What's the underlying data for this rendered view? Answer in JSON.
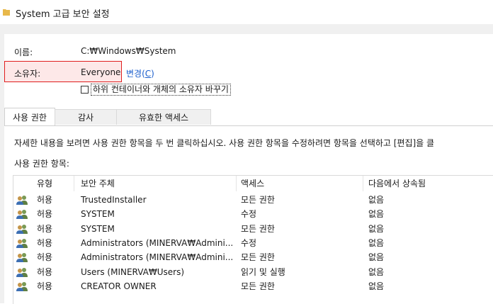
{
  "window": {
    "title": "System 고급 보안 설정",
    "icon": "folder-icon"
  },
  "fields": {
    "name_label": "이름:",
    "name_value": "C:₩Windows₩System",
    "owner_label": "소유자:",
    "owner_value": "Everyone",
    "change_label": "변경(",
    "change_hotkey": "C",
    "change_tail": ")",
    "replace_owner_checkbox": {
      "label": "하위 컨테이너와 개체의 소유자 바꾸기",
      "checked": false
    }
  },
  "tabs": [
    {
      "label": "사용 권한",
      "active": true
    },
    {
      "label": "감사",
      "active": false
    },
    {
      "label": "유효한 액세스",
      "active": false
    }
  ],
  "instructions": "자세한 내용을 보려면 사용 권한 항목을 두 번 클릭하십시오. 사용 권한 항목을 수정하려면 항목을 선택하고 [편집]을 클",
  "entries_label": "사용 권한 항목:",
  "table": {
    "columns": [
      "유형",
      "보안 주체",
      "액세스",
      "다음에서 상속됨"
    ],
    "rows": [
      {
        "type": "허용",
        "principal": "TrustedInstaller",
        "access": "모든 권한",
        "inherited": "없음"
      },
      {
        "type": "허용",
        "principal": "SYSTEM",
        "access": "수정",
        "inherited": "없음"
      },
      {
        "type": "허용",
        "principal": "SYSTEM",
        "access": "모든 권한",
        "inherited": "없음"
      },
      {
        "type": "허용",
        "principal": "Administrators (MINERVA₩Admini...",
        "access": "수정",
        "inherited": "없음"
      },
      {
        "type": "허용",
        "principal": "Administrators (MINERVA₩Admini...",
        "access": "모든 권한",
        "inherited": "없음"
      },
      {
        "type": "허용",
        "principal": "Users (MINERVA₩Users)",
        "access": "읽기 및 실행",
        "inherited": "없음"
      },
      {
        "type": "허용",
        "principal": "CREATOR OWNER",
        "access": "모든 권한",
        "inherited": "없음"
      }
    ]
  },
  "colors": {
    "highlight_border": "#e01e1e",
    "link": "#1a5dcc",
    "folder": "#e8b84a"
  }
}
